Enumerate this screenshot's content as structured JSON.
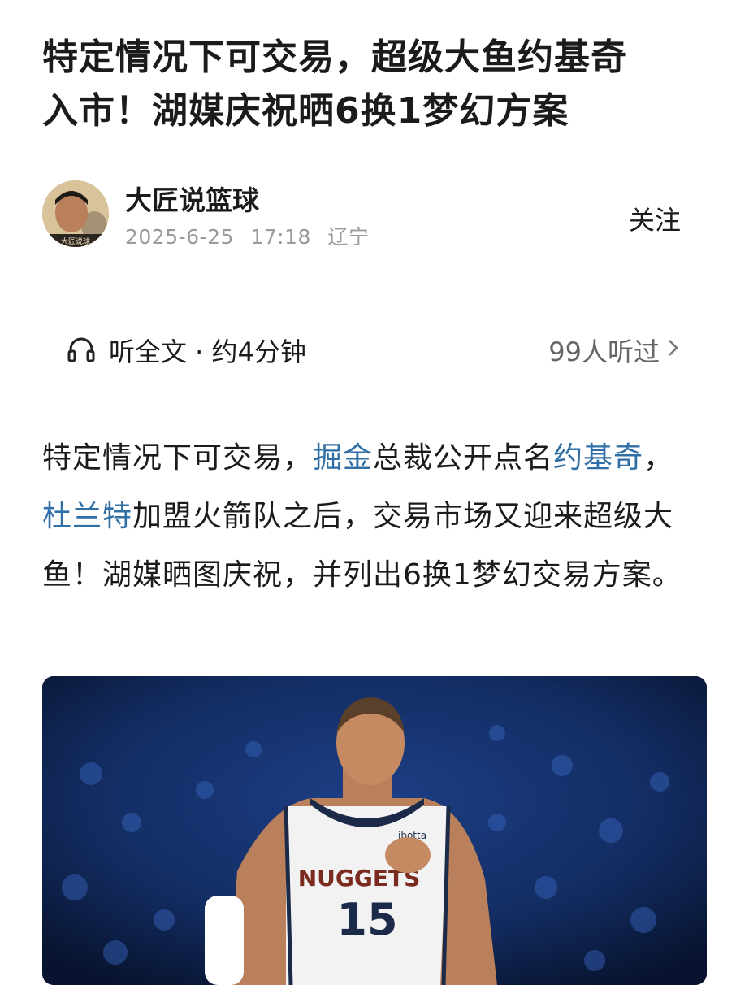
{
  "article": {
    "title_line1": "特定情况下可交易，超级大鱼约基奇",
    "title_line2": "入市！湖媒庆祝晒6换1梦幻方案"
  },
  "author": {
    "name": "大匠说篮球",
    "date": "2025-6-25",
    "time": "17:18",
    "location": "辽宁",
    "follow_label": "关注",
    "avatar_caption": "大匠说球"
  },
  "listen": {
    "label": "听全文 · 约4分钟",
    "count": "99人听过"
  },
  "body": {
    "p1": "特定情况下可交易，",
    "link1": "掘金",
    "p2": "总裁公开点名",
    "link2": "约基奇",
    "p3": "，",
    "link3": "杜兰特",
    "p4": "加盟火箭队之后，交易市场又迎来超级大鱼！湖媒晒图庆祝，并列出6换1梦幻交易方案。"
  },
  "photo": {
    "jersey_team": "NUGGETS",
    "jersey_number": "15",
    "sponsor": "ibotta"
  }
}
